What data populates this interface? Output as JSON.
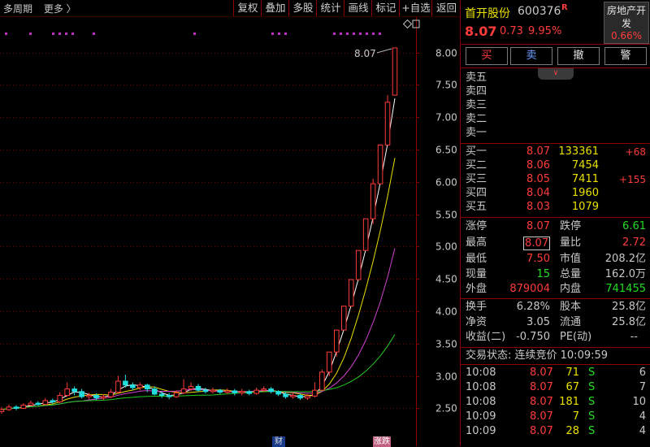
{
  "toolbar": {
    "period": "多周期",
    "more": "更多 〉",
    "buttons": [
      "复权",
      "叠加",
      "多股",
      "统计",
      "画线",
      "标记",
      "+自选",
      "返回"
    ]
  },
  "chart_data": {
    "type": "candlestick",
    "price_axis": [
      "8.00",
      "7.50",
      "7.00",
      "6.50",
      "6.00",
      "5.50",
      "5.00",
      "4.50",
      "4.00",
      "3.50",
      "3.00",
      "2.50"
    ],
    "ylim": [
      2.38,
      8.22
    ],
    "last_price_label": "8.07",
    "bottom_markers": [
      "财",
      "涨跌"
    ],
    "candles": [
      {
        "o": 2.45,
        "c": 2.48,
        "h": 2.52,
        "l": 2.42
      },
      {
        "o": 2.48,
        "c": 2.52,
        "h": 2.56,
        "l": 2.46
      },
      {
        "o": 2.52,
        "c": 2.5,
        "h": 2.55,
        "l": 2.47
      },
      {
        "o": 2.5,
        "c": 2.55,
        "h": 2.58,
        "l": 2.49
      },
      {
        "o": 2.55,
        "c": 2.58,
        "h": 2.62,
        "l": 2.53
      },
      {
        "o": 2.58,
        "c": 2.56,
        "h": 2.61,
        "l": 2.54
      },
      {
        "o": 2.56,
        "c": 2.62,
        "h": 2.66,
        "l": 2.55
      },
      {
        "o": 2.62,
        "c": 2.6,
        "h": 2.65,
        "l": 2.57
      },
      {
        "o": 2.6,
        "c": 2.7,
        "h": 2.75,
        "l": 2.58
      },
      {
        "o": 2.7,
        "c": 2.8,
        "h": 2.9,
        "l": 2.68
      },
      {
        "o": 2.8,
        "c": 2.76,
        "h": 2.84,
        "l": 2.7
      },
      {
        "o": 2.76,
        "c": 2.68,
        "h": 2.8,
        "l": 2.65
      },
      {
        "o": 2.68,
        "c": 2.7,
        "h": 2.74,
        "l": 2.64
      },
      {
        "o": 2.7,
        "c": 2.66,
        "h": 2.73,
        "l": 2.63
      },
      {
        "o": 2.66,
        "c": 2.68,
        "h": 2.72,
        "l": 2.63
      },
      {
        "o": 2.68,
        "c": 2.75,
        "h": 2.8,
        "l": 2.66
      },
      {
        "o": 2.75,
        "c": 2.92,
        "h": 3.0,
        "l": 2.73
      },
      {
        "o": 2.92,
        "c": 2.86,
        "h": 3.02,
        "l": 2.82
      },
      {
        "o": 2.86,
        "c": 2.82,
        "h": 2.9,
        "l": 2.78
      },
      {
        "o": 2.82,
        "c": 2.86,
        "h": 2.9,
        "l": 2.78
      },
      {
        "o": 2.86,
        "c": 2.8,
        "h": 2.88,
        "l": 2.75
      },
      {
        "o": 2.8,
        "c": 2.72,
        "h": 2.84,
        "l": 2.7
      },
      {
        "o": 2.72,
        "c": 2.7,
        "h": 2.76,
        "l": 2.66
      },
      {
        "o": 2.7,
        "c": 2.68,
        "h": 2.74,
        "l": 2.64
      },
      {
        "o": 2.68,
        "c": 2.74,
        "h": 2.78,
        "l": 2.66
      },
      {
        "o": 2.74,
        "c": 2.8,
        "h": 2.95,
        "l": 2.72
      },
      {
        "o": 2.8,
        "c": 2.84,
        "h": 2.9,
        "l": 2.77
      },
      {
        "o": 2.84,
        "c": 2.78,
        "h": 2.88,
        "l": 2.75
      },
      {
        "o": 2.78,
        "c": 2.76,
        "h": 2.82,
        "l": 2.73
      },
      {
        "o": 2.76,
        "c": 2.78,
        "h": 2.82,
        "l": 2.73
      },
      {
        "o": 2.78,
        "c": 2.75,
        "h": 2.8,
        "l": 2.72
      },
      {
        "o": 2.75,
        "c": 2.77,
        "h": 2.81,
        "l": 2.72
      },
      {
        "o": 2.77,
        "c": 2.74,
        "h": 2.8,
        "l": 2.7
      },
      {
        "o": 2.74,
        "c": 2.76,
        "h": 2.8,
        "l": 2.7
      },
      {
        "o": 2.76,
        "c": 2.73,
        "h": 2.79,
        "l": 2.7
      },
      {
        "o": 2.73,
        "c": 2.78,
        "h": 2.82,
        "l": 2.71
      },
      {
        "o": 2.78,
        "c": 2.8,
        "h": 2.84,
        "l": 2.75
      },
      {
        "o": 2.8,
        "c": 2.76,
        "h": 2.83,
        "l": 2.73
      },
      {
        "o": 2.76,
        "c": 2.72,
        "h": 2.78,
        "l": 2.69
      },
      {
        "o": 2.72,
        "c": 2.68,
        "h": 2.76,
        "l": 2.65
      },
      {
        "o": 2.68,
        "c": 2.7,
        "h": 2.74,
        "l": 2.65
      },
      {
        "o": 2.7,
        "c": 2.66,
        "h": 2.73,
        "l": 2.63
      },
      {
        "o": 2.66,
        "c": 2.69,
        "h": 2.72,
        "l": 2.63
      },
      {
        "o": 2.69,
        "c": 2.78,
        "h": 2.9,
        "l": 2.67
      },
      {
        "o": 2.78,
        "c": 3.06,
        "h": 3.1,
        "l": 2.78
      },
      {
        "o": 3.06,
        "c": 3.37,
        "h": 3.37,
        "l": 3.0
      },
      {
        "o": 3.37,
        "c": 3.71,
        "h": 3.71,
        "l": 3.3
      },
      {
        "o": 3.71,
        "c": 4.08,
        "h": 4.08,
        "l": 3.95
      },
      {
        "o": 4.08,
        "c": 4.49,
        "h": 4.49,
        "l": 4.2
      },
      {
        "o": 4.49,
        "c": 4.94,
        "h": 4.94,
        "l": 4.6
      },
      {
        "o": 4.94,
        "c": 5.43,
        "h": 5.43,
        "l": 5.0
      },
      {
        "o": 5.43,
        "c": 5.97,
        "h": 6.05,
        "l": 5.35
      },
      {
        "o": 5.97,
        "c": 6.57,
        "h": 6.57,
        "l": 6.1
      },
      {
        "o": 6.57,
        "c": 7.23,
        "h": 7.34,
        "l": 6.8
      },
      {
        "o": 7.34,
        "c": 8.07,
        "h": 8.07,
        "l": 7.5
      }
    ]
  },
  "quote": {
    "name": "首开股份",
    "code": "600376",
    "flag": "R",
    "price": "8.07",
    "change": "0.73",
    "pct": "9.95%",
    "sector": "房地产开发",
    "sector_pct": "0.66%"
  },
  "trade_buttons": [
    "买",
    "卖",
    "撤",
    "警"
  ],
  "asks": [
    "卖五",
    "卖四",
    "卖三",
    "卖二",
    "卖一"
  ],
  "bids": [
    {
      "label": "买一",
      "price": "8.07",
      "vol": "133361",
      "chg": "+68"
    },
    {
      "label": "买二",
      "price": "8.06",
      "vol": "7454",
      "chg": ""
    },
    {
      "label": "买三",
      "price": "8.05",
      "vol": "7411",
      "chg": "+155"
    },
    {
      "label": "买四",
      "price": "8.04",
      "vol": "1960",
      "chg": ""
    },
    {
      "label": "买五",
      "price": "8.03",
      "vol": "1079",
      "chg": ""
    }
  ],
  "stats": {
    "zt_label": "涨停",
    "zt": "8.07",
    "dt_label": "跌停",
    "dt": "6.61",
    "high_label": "最高",
    "high": "8.07",
    "lb_label": "量比",
    "lb": "2.72",
    "low_label": "最低",
    "low": "7.50",
    "sz_label": "市值",
    "sz": "208.2亿",
    "now_label": "现量",
    "now": "15",
    "zl_label": "总量",
    "zl": "162.0万",
    "wp_label": "外盘",
    "wp": "879004",
    "np_label": "内盘",
    "np": "741455",
    "hs_label": "换手",
    "hs": "6.28%",
    "gb_label": "股本",
    "gb": "25.8亿",
    "jz_label": "净资",
    "jz": "3.05",
    "lt_label": "流通",
    "lt": "25.8亿",
    "sy_label": "收益(二)",
    "sy": "-0.750",
    "pe_label": "PE(动)",
    "pe": "--"
  },
  "trade_status": "交易状态: 连续竞价 10:09:59",
  "ticks": [
    {
      "t": "10:08",
      "p": "8.07",
      "v": "71",
      "d": "S",
      "n": "6"
    },
    {
      "t": "10:08",
      "p": "8.07",
      "v": "67",
      "d": "S",
      "n": "7"
    },
    {
      "t": "10:08",
      "p": "8.07",
      "v": "181",
      "d": "S",
      "n": "10"
    },
    {
      "t": "10:09",
      "p": "8.07",
      "v": "7",
      "d": "S",
      "n": "4"
    },
    {
      "t": "10:09",
      "p": "8.07",
      "v": "28",
      "d": "S",
      "n": "4"
    }
  ],
  "colors": {
    "up": "#ff3b3b",
    "down": "#22dddd",
    "ma1": "#ffffff",
    "ma2": "#e8e000",
    "ma3": "#d040d0",
    "ma4": "#22cc22"
  }
}
